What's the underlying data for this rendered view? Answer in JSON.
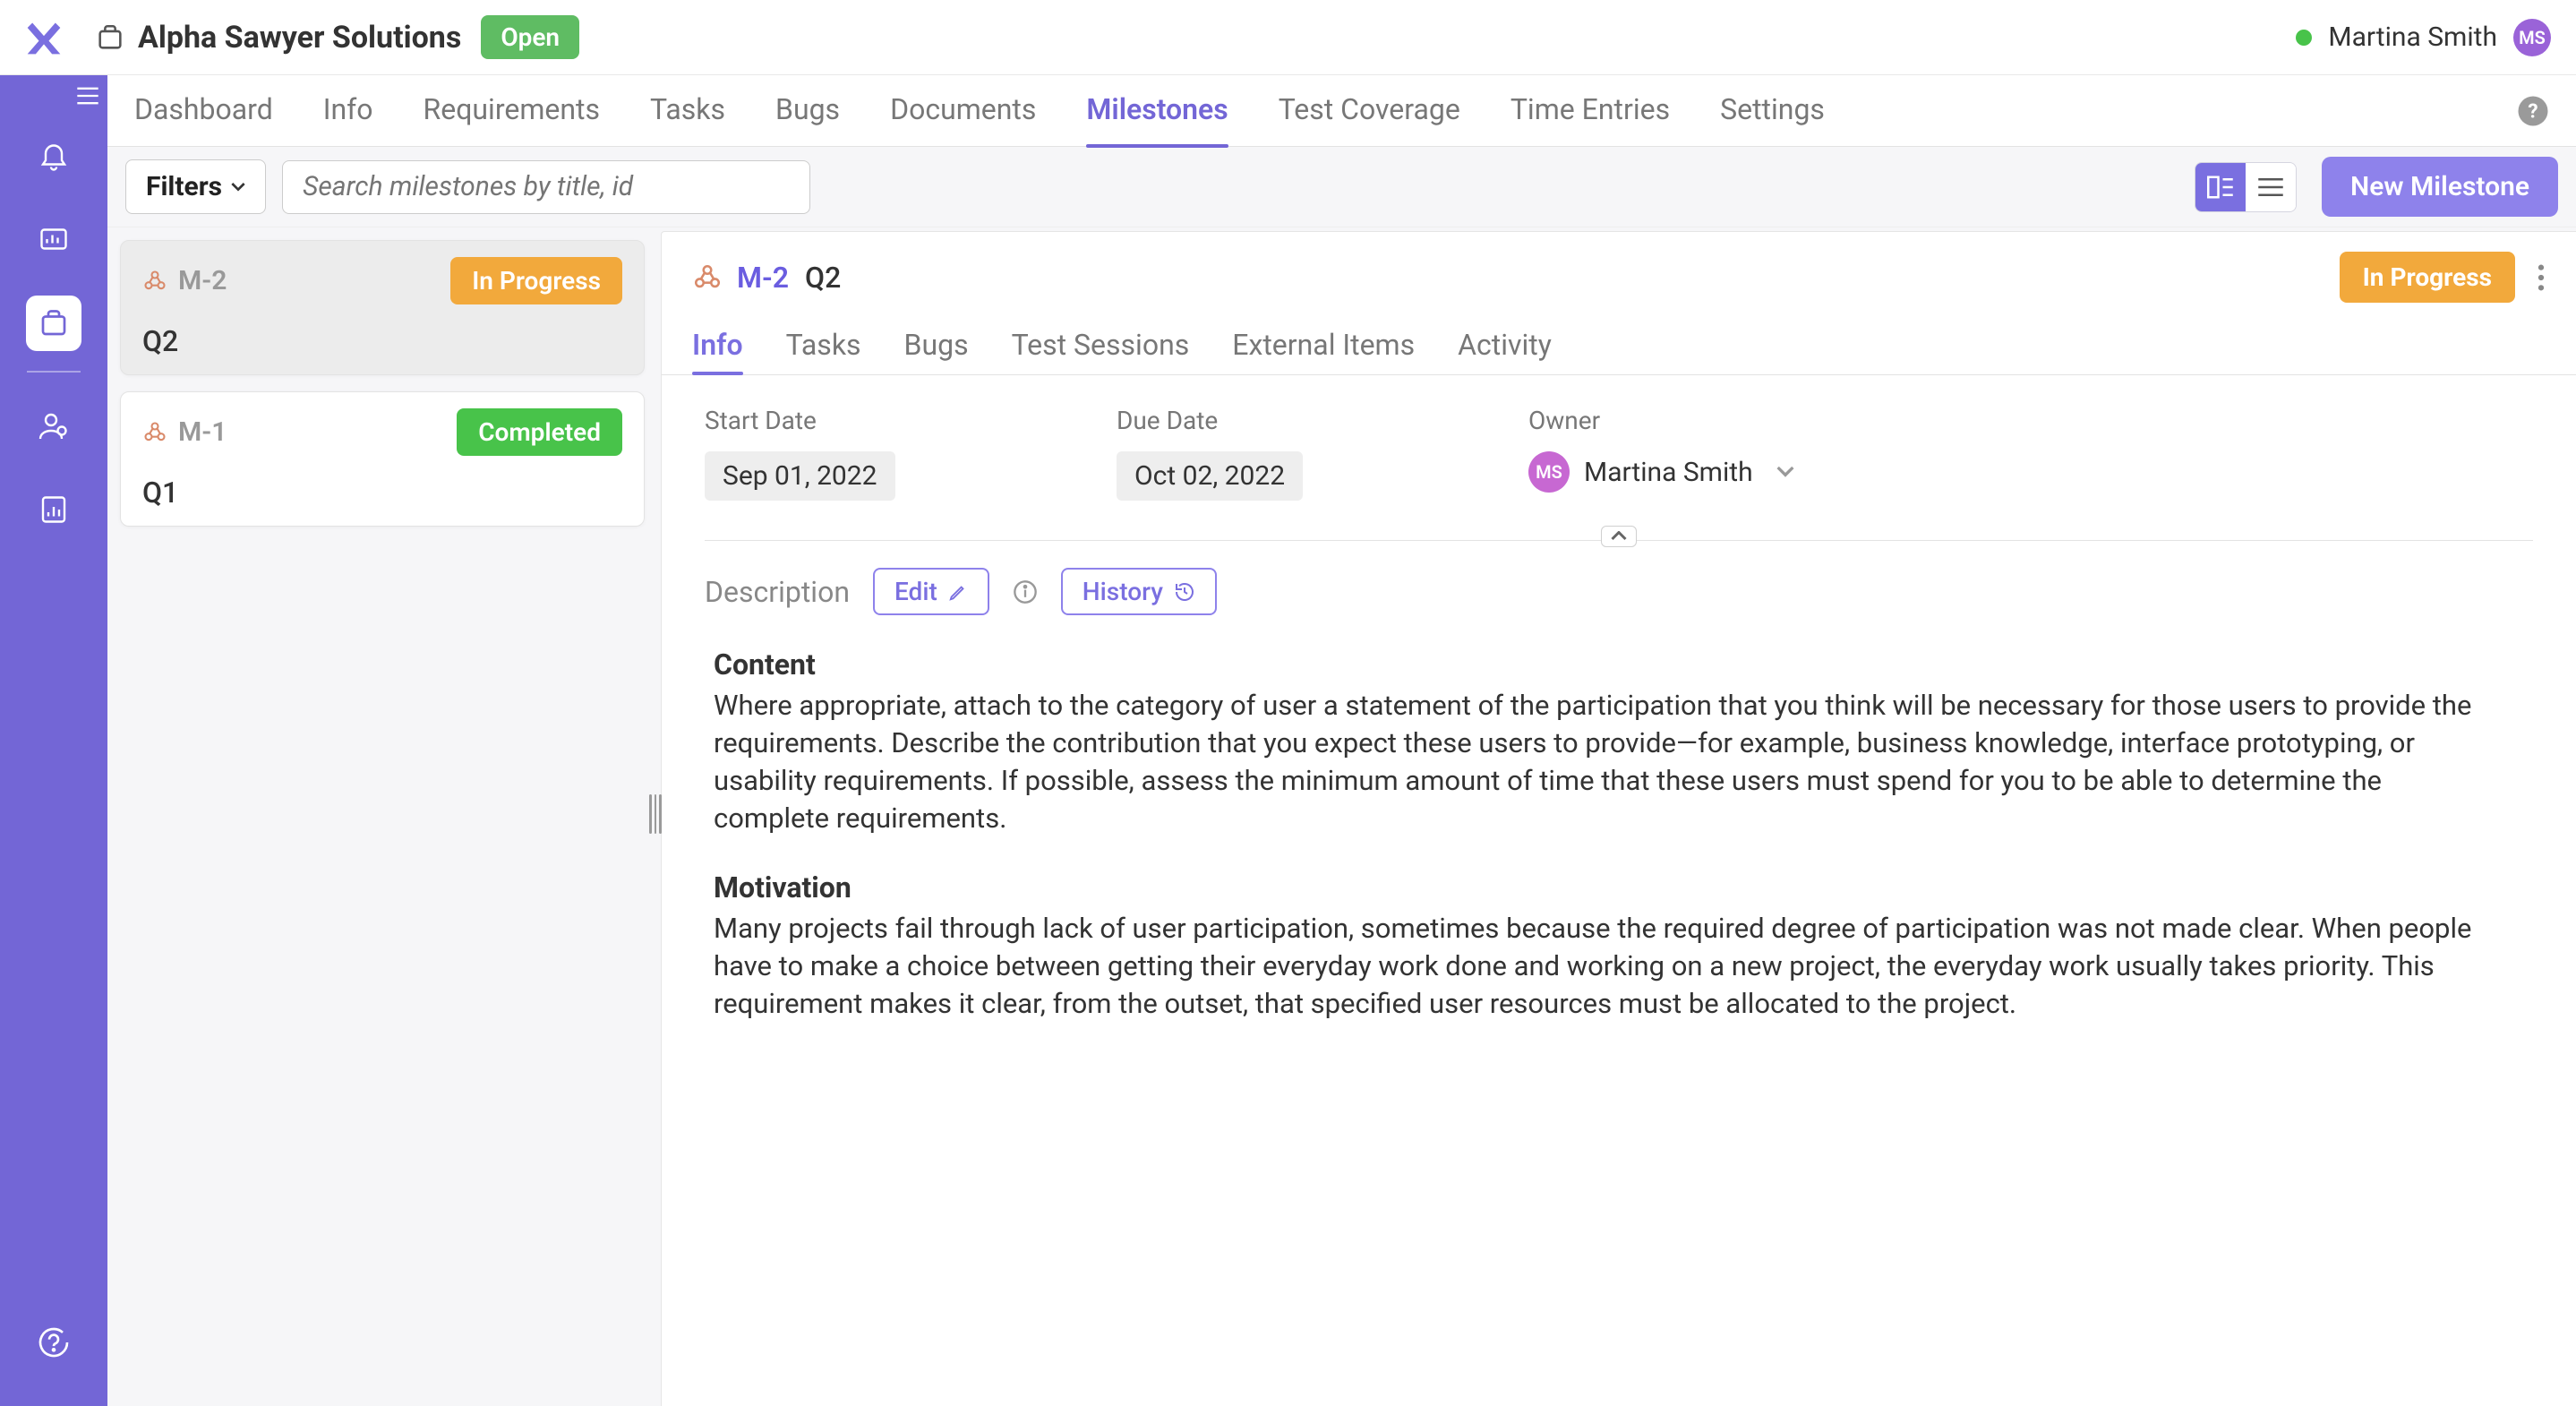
{
  "header": {
    "project_title": "Alpha Sawyer Solutions",
    "open_badge": "Open",
    "user_name": "Martina Smith",
    "user_initials": "MS"
  },
  "nav": {
    "tabs": [
      "Dashboard",
      "Info",
      "Requirements",
      "Tasks",
      "Bugs",
      "Documents",
      "Milestones",
      "Test Coverage",
      "Time Entries",
      "Settings"
    ],
    "active": "Milestones"
  },
  "toolbar": {
    "filters_label": "Filters",
    "search_placeholder": "Search milestones by title, id",
    "new_label": "New Milestone"
  },
  "milestones": [
    {
      "id": "M-2",
      "title": "Q2",
      "status": "In Progress",
      "status_class": "inprogress",
      "selected": true
    },
    {
      "id": "M-1",
      "title": "Q1",
      "status": "Completed",
      "status_class": "completed",
      "selected": false
    }
  ],
  "detail": {
    "id": "M-2",
    "title": "Q2",
    "status": "In Progress",
    "tabs": [
      "Info",
      "Tasks",
      "Bugs",
      "Test Sessions",
      "External Items",
      "Activity"
    ],
    "active_tab": "Info",
    "start_date_label": "Start Date",
    "start_date": "Sep 01, 2022",
    "due_date_label": "Due Date",
    "due_date": "Oct 02, 2022",
    "owner_label": "Owner",
    "owner_name": "Martina Smith",
    "owner_initials": "MS",
    "description_label": "Description",
    "edit_label": "Edit",
    "history_label": "History",
    "content_heading": "Content",
    "content_body": "Where appropriate, attach to the category of user a statement of the participation that you think will be necessary for those users to provide the requirements. Describe the contribution that you expect these users to provide—for example, business knowledge, interface prototyping, or usability requirements. If possible, assess the minimum amount of time that these users must spend for you to be able to determine the complete requirements.",
    "motivation_heading": "Motivation",
    "motivation_body": "Many projects fail through lack of user participation, sometimes because the required degree of participation was not made clear. When people have to make a choice between getting their everyday work done and working on a new project, the everyday work usually takes priority. This requirement makes it clear, from the outset, that specified user resources must be allocated to the project."
  }
}
